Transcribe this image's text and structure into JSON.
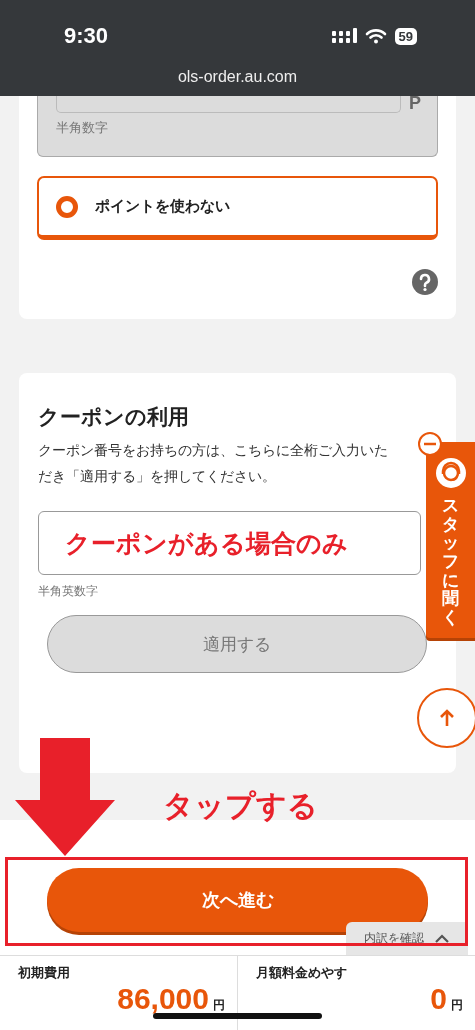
{
  "status_bar": {
    "time": "9:30",
    "battery": "59"
  },
  "address_bar": {
    "url": "ols-order.au.com"
  },
  "points_card": {
    "points_field": {
      "unit": "P",
      "hint": "半角数字",
      "disabled": true
    },
    "options": [
      {
        "label": "ポイントを使わない",
        "selected": true
      }
    ]
  },
  "coupon_card": {
    "title": "クーポンの利用",
    "description": "クーポン番号をお持ちの方は、こちらに全桁ご入力いただき「適用する」を押してください。",
    "field": {
      "hint": "半角英数字"
    },
    "apply_button": {
      "label": "適用する",
      "disabled": true
    }
  },
  "staff_tab": {
    "label": "スタッフに聞く"
  },
  "annotations": {
    "coupon_note": "クーポンがある場合のみ",
    "tap_note": "タップする"
  },
  "footer": {
    "next_button": "次へ進む",
    "breakdown_toggle": {
      "label": "内訳を確認",
      "expanded": false
    },
    "costs": [
      {
        "label": "初期費用",
        "amount": "86,000",
        "unit": "円"
      },
      {
        "label": "月額料金めやす",
        "amount": "0",
        "unit": "円"
      }
    ]
  }
}
